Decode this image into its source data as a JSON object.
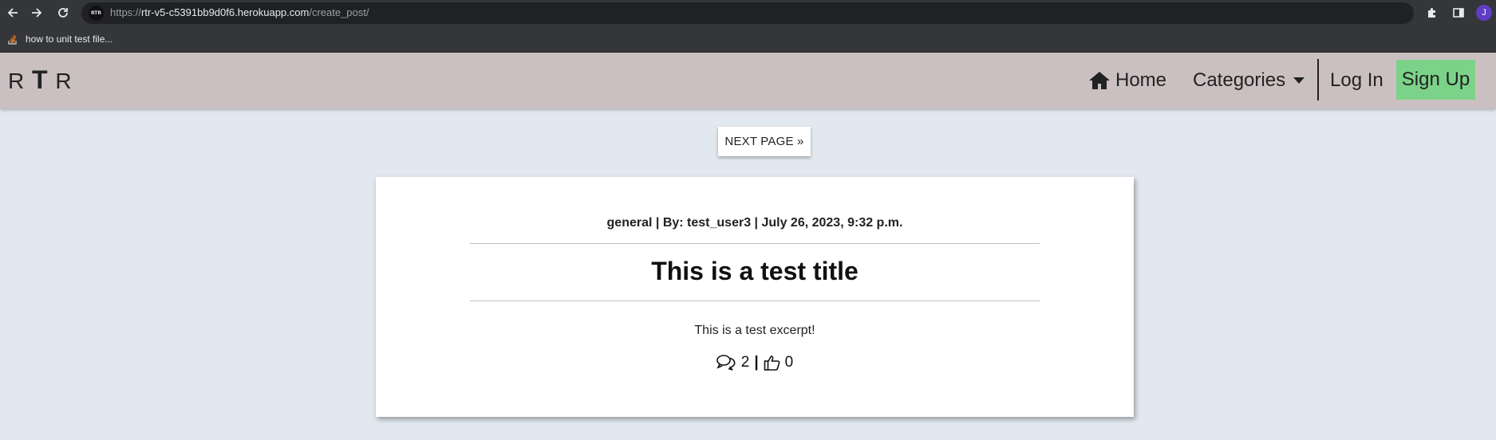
{
  "browser": {
    "url_scheme": "https://",
    "url_host": "rtr-v5-c5391bb9d0f6.herokuapp.com",
    "url_path": "/create_post/",
    "site_badge": "RTR",
    "profile_initial": "J",
    "bookmark_label": "how to unit test file..."
  },
  "nav": {
    "brand_left": "R",
    "brand_mid": "T",
    "brand_right": "R",
    "home": "Home",
    "categories": "Categories",
    "login": "Log In",
    "signup": "Sign Up",
    "signup_color": "#7bd389",
    "bg_color": "#cbc0c1"
  },
  "pagination": {
    "next": "NEXT PAGE »"
  },
  "post": {
    "meta": "general | By: test_user3 | July 26, 2023, 9:32 p.m.",
    "title": "This is a test title",
    "excerpt": "This is a test excerpt!",
    "comments": "2",
    "separator": "|",
    "likes": "0"
  }
}
